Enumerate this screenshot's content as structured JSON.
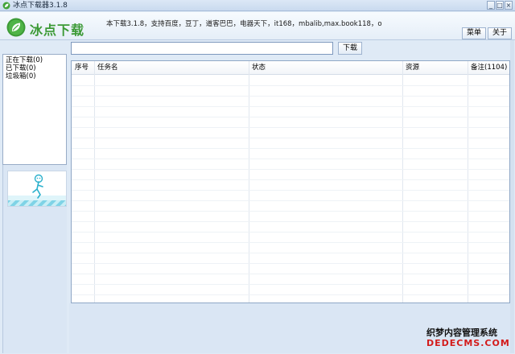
{
  "window": {
    "title": "冰点下载器3.1.8",
    "min_glyph": "_",
    "max_glyph": "□",
    "close_glyph": "×"
  },
  "header": {
    "logo_text": "冰点下载",
    "info_text": "本下载3.1.8，支持百度，豆丁，道客巴巴，电器天下，it168，mbalib,max.book118，o",
    "menu_label": "菜单",
    "about_label": "关于"
  },
  "sidebar": {
    "items": [
      {
        "label": "正在下载(0)"
      },
      {
        "label": "已下载(0)"
      },
      {
        "label": "垃圾箱(0)"
      }
    ]
  },
  "toolbar": {
    "url_value": "",
    "url_placeholder": "",
    "download_label": "下载"
  },
  "table": {
    "columns": [
      "序号",
      "任务名",
      "状态",
      "资源",
      "备注(1104)"
    ],
    "rows": []
  },
  "watermark": {
    "line1": "织梦内容管理系统",
    "line2": "DEDECMS.COM"
  },
  "colors": {
    "logo_green": "#3c9a36",
    "watermark_red": "#d31b1b",
    "border_blue": "#8fa7c6"
  },
  "icons": {
    "app": "leaf-icon",
    "logo": "leaf-logo-icon",
    "ad": "mascot-illustration"
  }
}
